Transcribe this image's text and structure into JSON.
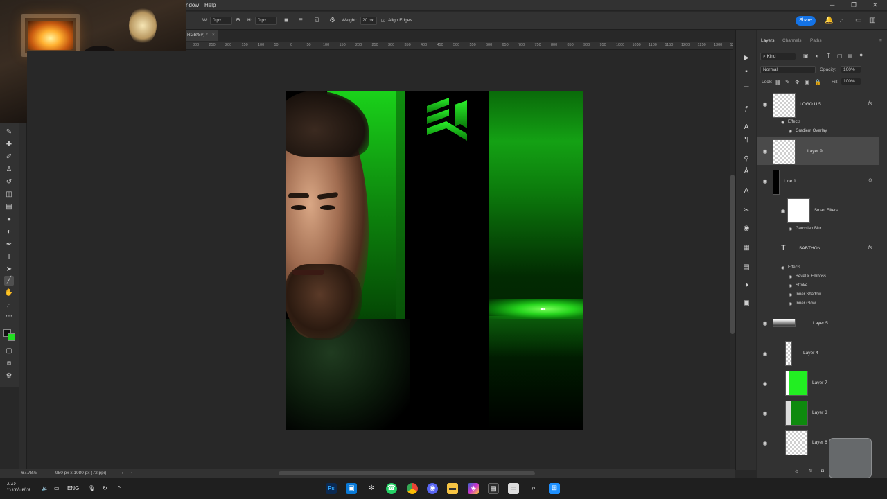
{
  "menubar": {
    "items": [
      "ndow",
      "Help"
    ],
    "window_controls": [
      "─",
      "❐",
      "✕"
    ]
  },
  "options": {
    "w_label": "W:",
    "w_value": "0 px",
    "h_label": "H:",
    "h_value": "0 px",
    "weight_label": "Weight:",
    "weight_value": "20 px",
    "align_edges": "Align Edges",
    "share": "Share"
  },
  "document": {
    "tab": "RGB/8#) *"
  },
  "ruler": [
    "300",
    "250",
    "200",
    "150",
    "100",
    "50",
    "0",
    "50",
    "100",
    "150",
    "200",
    "250",
    "300",
    "350",
    "400",
    "450",
    "500",
    "550",
    "600",
    "650",
    "700",
    "750",
    "800",
    "850",
    "900",
    "950",
    "1000",
    "1050",
    "1100",
    "1150",
    "1200",
    "1250",
    "1300",
    "1350"
  ],
  "status": {
    "zoom": "67.78%",
    "doc_size": "950 px x 1080 px (72 ppi)"
  },
  "layers_panel": {
    "tabs": [
      "Layers",
      "Channels",
      "Paths"
    ],
    "filter": "Kind",
    "blend_mode": "Normal",
    "opacity_label": "Opacity:",
    "opacity": "100%",
    "lock_label": "Lock:",
    "fill_label": "Fill:",
    "fill": "100%",
    "layers": [
      {
        "name": "LOGO U 5",
        "effects_label": "Effects",
        "effects": [
          "Gradient Overlay"
        ]
      },
      {
        "name": "Layer 9"
      },
      {
        "name": "Line 1",
        "smart_filters": "Smart Filters",
        "filters": [
          "Gaussian Blur"
        ]
      },
      {
        "name": "SABTHON",
        "effects_label": "Effects",
        "effects": [
          "Bevel & Emboss",
          "Stroke",
          "Inner Shadow",
          "Inner Glow"
        ]
      },
      {
        "name": "Layer 5"
      },
      {
        "name": "Layer 4"
      },
      {
        "name": "Layer 7"
      },
      {
        "name": "Layer 3"
      },
      {
        "name": "Layer 6"
      }
    ]
  },
  "taskbar": {
    "language": "ENG",
    "clock_line1": "۸:۸۶",
    "clock_line2": "۲۰۲۴/۰۶/۲۶"
  },
  "colors": {
    "accent_green": "#22dd22",
    "share_blue": "#1473e6"
  }
}
